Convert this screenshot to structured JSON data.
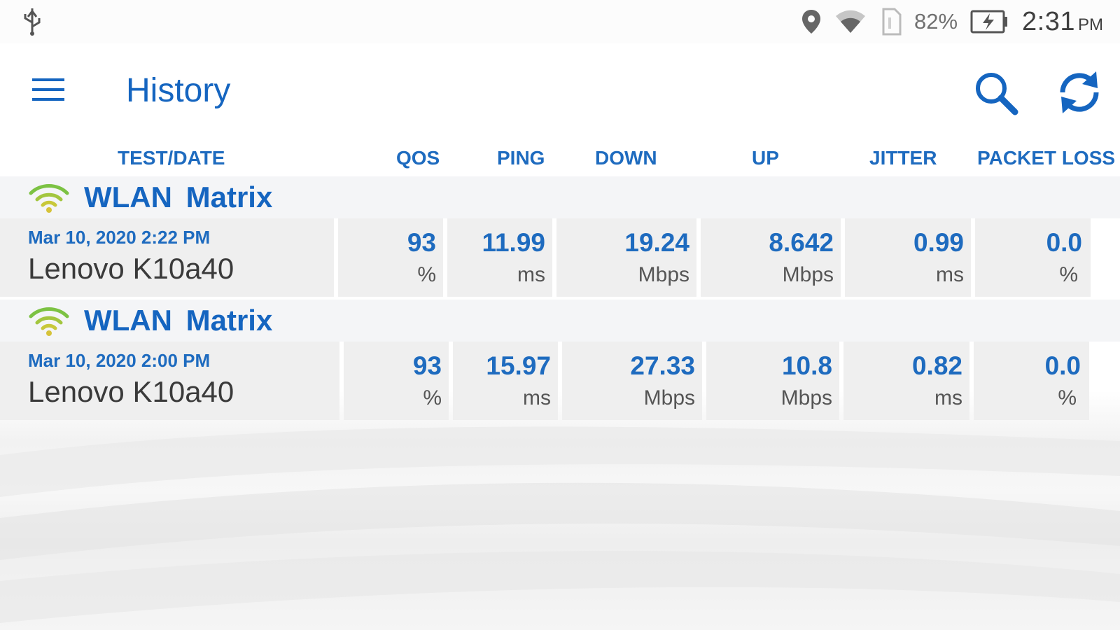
{
  "status_bar": {
    "battery_percent": "82%",
    "time": "2:31",
    "am_pm": "PM",
    "icons": [
      "usb-icon",
      "location-icon",
      "wifi-signal-icon",
      "sim-icon",
      "battery-charging-icon"
    ]
  },
  "app_bar": {
    "title": "History",
    "icons": [
      "menu-icon",
      "search-icon",
      "refresh-icon"
    ]
  },
  "columns": [
    "TEST/DATE",
    "QOS",
    "PING",
    "DOWN",
    "UP",
    "JITTER",
    "PACKET LOSS"
  ],
  "entries": [
    {
      "network": "WLAN Matrix",
      "date": "Mar 10, 2020 2:22 PM",
      "device": "Lenovo K10a40",
      "qos": {
        "value": "93",
        "unit": "%"
      },
      "ping": {
        "value": "11.99",
        "unit": "ms"
      },
      "down": {
        "value": "19.24",
        "unit": "Mbps"
      },
      "up": {
        "value": "8.642",
        "unit": "Mbps"
      },
      "jitter": {
        "value": "0.99",
        "unit": "ms"
      },
      "packet_loss": {
        "value": "0.0",
        "unit": "%"
      }
    },
    {
      "network": "WLAN Matrix",
      "date": "Mar 10, 2020 2:00 PM",
      "device": "Lenovo K10a40",
      "qos": {
        "value": "93",
        "unit": "%"
      },
      "ping": {
        "value": "15.97",
        "unit": "ms"
      },
      "down": {
        "value": "27.33",
        "unit": "Mbps"
      },
      "up": {
        "value": "10.8",
        "unit": "Mbps"
      },
      "jitter": {
        "value": "0.82",
        "unit": "ms"
      },
      "packet_loss": {
        "value": "0.0",
        "unit": "%"
      }
    }
  ],
  "colors": {
    "accent": "#1565c0",
    "header_text": "#1e6bbf",
    "row_bg": "#efefef",
    "group_bg": "#f4f5f7",
    "wifi_green": "#7cc243",
    "wifi_yellow": "#c8c83a"
  }
}
